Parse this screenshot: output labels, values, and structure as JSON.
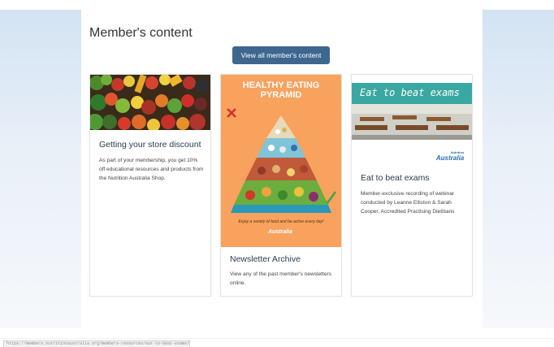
{
  "section": {
    "heading": "Member's content",
    "view_all_label": "View all member's content"
  },
  "cards": [
    {
      "title": "Getting your store discount",
      "description": "As part of your membership, you get 10% off educational resources and products from the Nutrition Australia Shop.",
      "image": "fruit-and-vegetables-photo"
    },
    {
      "title": "Newsletter Archive",
      "description": "View any of the past member's newsletters online.",
      "image": "healthy-eating-pyramid-poster",
      "poster": {
        "headline_line1": "HEALTHY EATING",
        "headline_line2": "PYRAMID",
        "tagline": "Enjoy a variety of food and be active every day!",
        "brand": "Australia"
      }
    },
    {
      "title": "Eat to beat exams",
      "description": "Member-exclusive recording of webinar conducted by Leanne Elliston & Sarah Cooper, Accredited Practising Dietitians",
      "image": "classroom-banner",
      "banner": {
        "text": "Eat to beat exams",
        "brand_small": "Nutrition",
        "brand": "Australia"
      }
    }
  ],
  "status_bar": {
    "url": "https://members.nutritionaustralia.org/members-resources/eat-to-beat-exams/"
  },
  "colors": {
    "button_bg": "#3e678f",
    "poster_bg": "#f8a25e",
    "banner_bg": "#3aa7a0"
  }
}
